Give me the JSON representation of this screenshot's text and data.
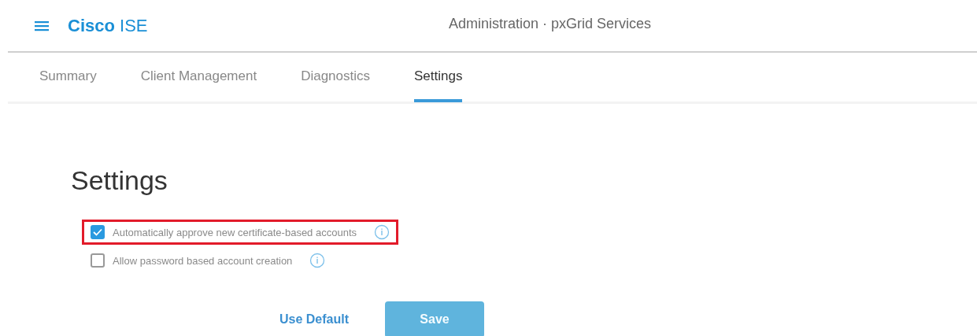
{
  "header": {
    "brand": "Cisco",
    "product": "ISE",
    "title": "Administration · pxGrid Services"
  },
  "tabs": [
    {
      "label": "Summary",
      "selected": false
    },
    {
      "label": "Client Management",
      "selected": false
    },
    {
      "label": "Diagnostics",
      "selected": false
    },
    {
      "label": "Settings",
      "selected": true
    }
  ],
  "heading": "Settings",
  "options": [
    {
      "label": "Automatically approve new certificate-based accounts",
      "checked": true,
      "highlighted": true
    },
    {
      "label": "Allow password based account creation",
      "checked": false,
      "highlighted": false
    }
  ],
  "buttons": [
    {
      "label": "Use Default",
      "kind": "link"
    },
    {
      "label": "Save",
      "kind": "primary",
      "disabled": true
    }
  ]
}
